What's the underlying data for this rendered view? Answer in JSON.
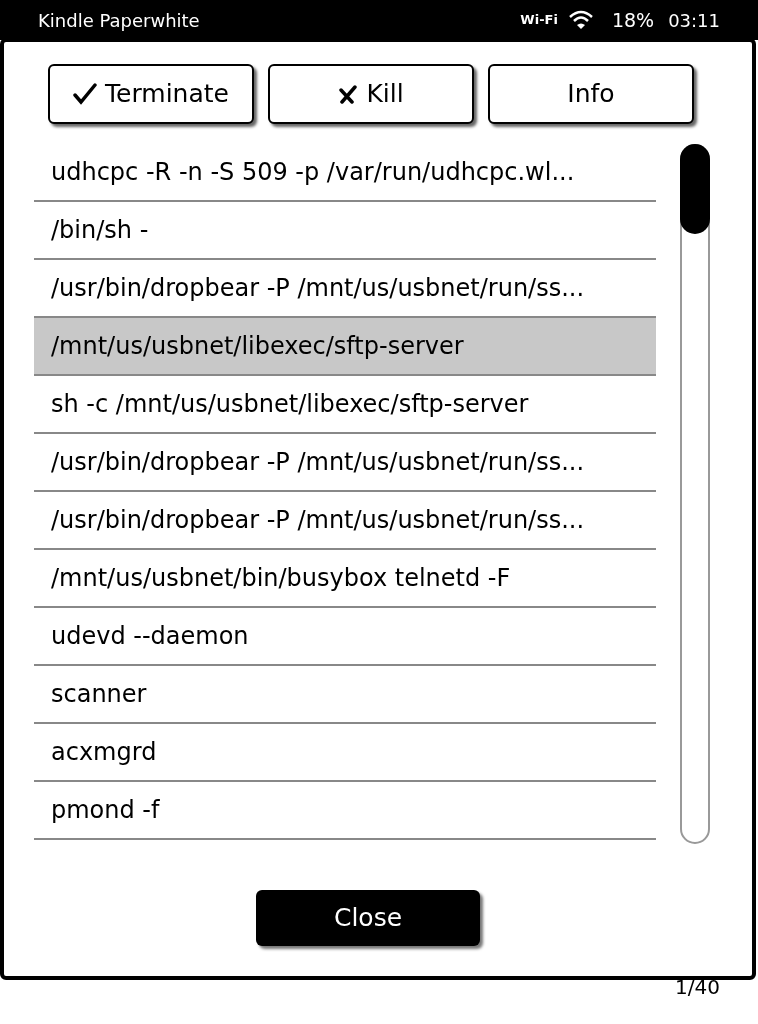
{
  "status_bar": {
    "device": "Kindle Paperwhite",
    "wifi_label": "Wi-Fi",
    "battery": "18%",
    "time": "03:11"
  },
  "actions": [
    {
      "label": "Terminate",
      "kind": "check"
    },
    {
      "label": "Kill",
      "kind": "cross"
    },
    {
      "label": "Info",
      "kind": "plain"
    }
  ],
  "processes": [
    {
      "command": "udhcpc -R -n -S 509 -p /var/run/udhcpc.wl...",
      "selected": false
    },
    {
      "command": "/bin/sh -",
      "selected": false
    },
    {
      "command": "/usr/bin/dropbear -P /mnt/us/usbnet/run/ss...",
      "selected": false
    },
    {
      "command": "/mnt/us/usbnet/libexec/sftp-server",
      "selected": true
    },
    {
      "command": "sh -c /mnt/us/usbnet/libexec/sftp-server",
      "selected": false
    },
    {
      "command": "/usr/bin/dropbear -P /mnt/us/usbnet/run/ss...",
      "selected": false
    },
    {
      "command": "/usr/bin/dropbear -P /mnt/us/usbnet/run/ss...",
      "selected": false
    },
    {
      "command": "/mnt/us/usbnet/bin/busybox telnetd -F",
      "selected": false
    },
    {
      "command": "udevd --daemon",
      "selected": false
    },
    {
      "command": "scanner",
      "selected": false
    },
    {
      "command": "acxmgrd",
      "selected": false
    },
    {
      "command": "pmond -f",
      "selected": false
    }
  ],
  "close_button": "Close",
  "page_number": "1/40"
}
